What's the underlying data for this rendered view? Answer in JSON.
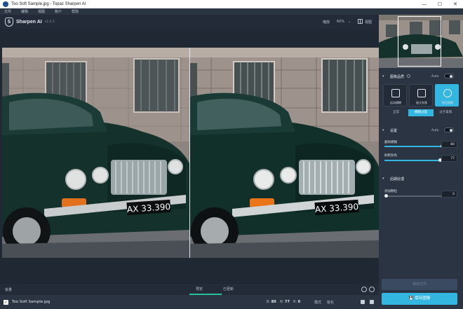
{
  "window": {
    "title": "Too Soft Sample.jpg - Topaz Sharpen AI",
    "minimize": "—",
    "maximize": "☐",
    "close": "✕"
  },
  "menu": [
    "文件",
    "编辑",
    "视图",
    "帐户",
    "帮助"
  ],
  "header": {
    "logo_glyph": "S",
    "app_name": "Sharpen AI",
    "version": "v2.2.2",
    "zoom_label": "缩放",
    "zoom_value": "60%",
    "zoom_caret": "⌄",
    "view_label": "视图"
  },
  "photo": {
    "plate_text": "AX 33.390"
  },
  "bottom_bar": {
    "left_label": "批量",
    "tab_preview": "预览",
    "tab_original": "已更新"
  },
  "file_row": {
    "checkbox_glyph": "✓",
    "file_name": "Too Soft Sample.jpg",
    "b_label": "B:",
    "b_value": "80",
    "n_label": "N:",
    "n_value": "77",
    "r_label": "R:",
    "r_value": "0",
    "mode_label": "模式",
    "mode_value": "锐化"
  },
  "panel": {
    "section_sharpen": {
      "title": "图像品质",
      "auto": "Auto",
      "modes": [
        {
          "label": "运动模糊"
        },
        {
          "label": "极大失焦"
        },
        {
          "label": "稳定模糊"
        }
      ],
      "segments": [
        "正常",
        "模糊过度",
        "过于柔和"
      ]
    },
    "section_settings": {
      "title": "设置",
      "auto": "Auto",
      "slider1_label": "删除模糊",
      "slider1_value": "80",
      "slider1_fraction": 0.8,
      "slider2_label": "抑制杂色",
      "slider2_value": "77",
      "slider2_fraction": 0.77
    },
    "section_post": {
      "title": "后期处理",
      "slider_label": "添加颗粒",
      "slider_value": "0",
      "slider_fraction": 0.0
    },
    "apply_label": "保存文件",
    "save_label": "保存图像",
    "save_icon": "💾"
  }
}
